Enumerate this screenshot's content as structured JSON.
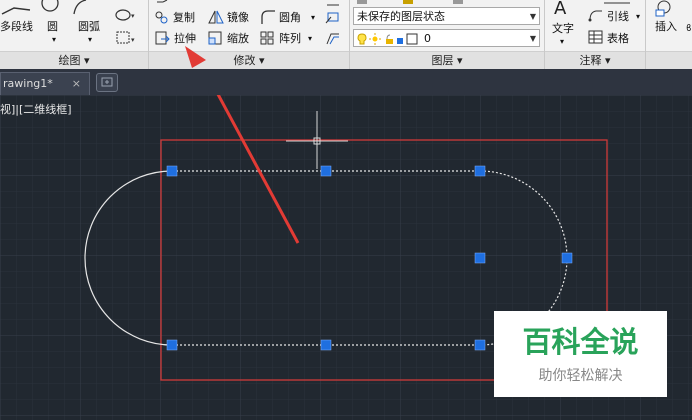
{
  "ribbon": {
    "draw_panel": {
      "polyline": "多段线",
      "circle": "圆",
      "arc": "圆弧",
      "footer": "绘图 ▾"
    },
    "modify_panel": {
      "copy": "复制",
      "mirror": "镜像",
      "fillet": "圆角",
      "stretch": "拉伸",
      "scale": "缩放",
      "array": "阵列",
      "footer": "修改 ▾"
    },
    "layers_panel": {
      "layer_state": "未保存的图层状态",
      "current_layer": "0",
      "footer": "图层 ▾"
    },
    "annotation_panel": {
      "text": "文字",
      "leader": "引线",
      "table": "表格",
      "footer": "注释 ▾"
    },
    "insert_panel": {
      "insert": "插入"
    }
  },
  "tabs": [
    {
      "label": "rawing1*",
      "close": "×"
    }
  ],
  "viewport": {
    "label": "视]|[二维线框]"
  },
  "watermark": {
    "title": "百科全说",
    "subtitle": "助你轻松解决"
  },
  "colors": {
    "canvas_bg": "#212830",
    "grip": "#1f6fe0",
    "selection_rect": "#d03a3a",
    "arrow": "#e23b35"
  }
}
